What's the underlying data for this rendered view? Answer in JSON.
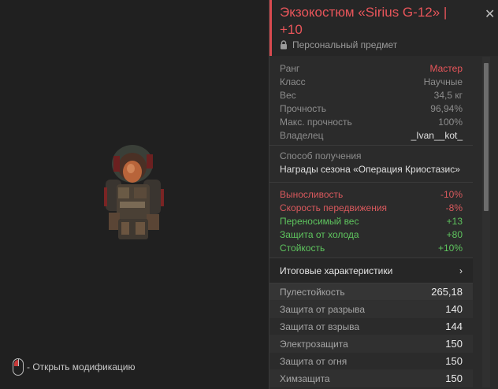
{
  "item": {
    "title": "Экзокостюм «Sirius G-12» | +10",
    "personal": "Персональный предмет"
  },
  "hint": "- Открыть модификацию",
  "info": [
    {
      "key": "Ранг",
      "value": "Мастер"
    },
    {
      "key": "Класс",
      "value": "Научные"
    },
    {
      "key": "Вес",
      "value": "34,5 кг"
    },
    {
      "key": "Прочность",
      "value": "96,94%"
    },
    {
      "key": "Макс. прочность",
      "value": "100%"
    },
    {
      "key": "Владелец",
      "value": "_Ivan__kot_"
    }
  ],
  "acquire": {
    "label": "Способ получения",
    "value": "Награды сезона «Операция Криостазис»"
  },
  "modifiers": [
    {
      "key": "Выносливость",
      "value": "-10%"
    },
    {
      "key": "Скорость передвижения",
      "value": "-8%"
    },
    {
      "key": "Переносимый вес",
      "value": "+13"
    },
    {
      "key": "Защита от холода",
      "value": "+80"
    },
    {
      "key": "Стойкость",
      "value": "+10%"
    }
  ],
  "totals_label": "Итоговые характеристики",
  "resists": [
    {
      "key": "Пулестойкость",
      "value": "265,18"
    },
    {
      "key": "Защита от разрыва",
      "value": "140"
    },
    {
      "key": "Защита от взрыва",
      "value": "144"
    },
    {
      "key": "Электрозащита",
      "value": "150"
    },
    {
      "key": "Защита от огня",
      "value": "150"
    },
    {
      "key": "Химзащита",
      "value": "150"
    }
  ],
  "colors": {
    "accent": "#e8555a",
    "positive": "#5ec45e",
    "negative": "#d9595d"
  }
}
